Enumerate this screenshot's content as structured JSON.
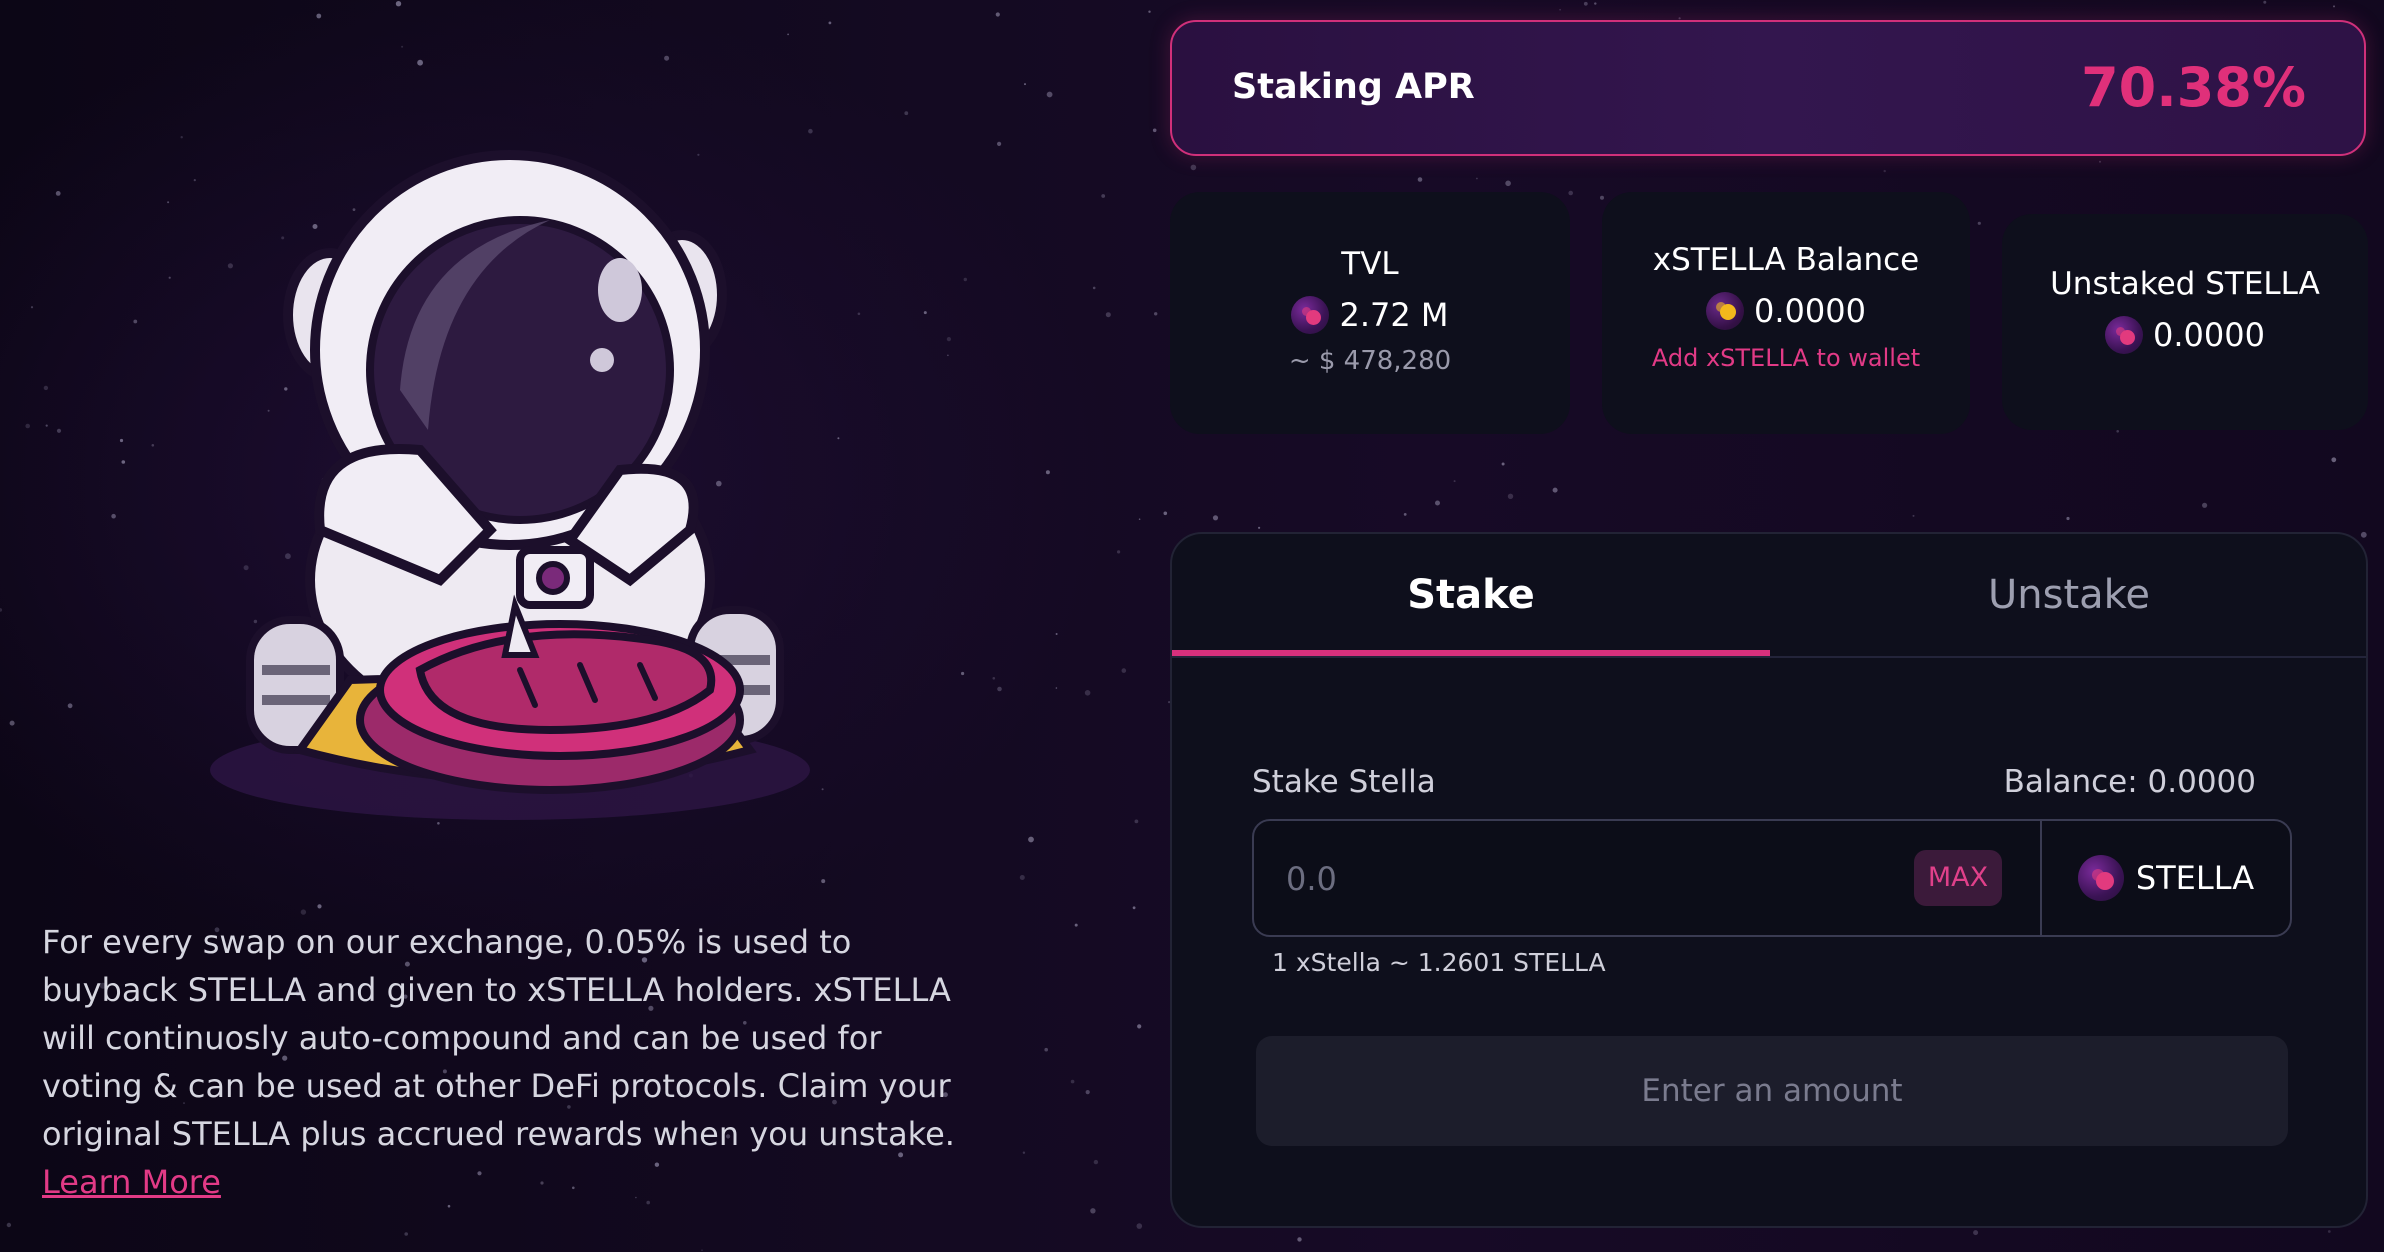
{
  "staking_apr": {
    "label": "Staking APR",
    "value": "70.38%"
  },
  "stats": {
    "tvl": {
      "title": "TVL",
      "amount": "2.72 M",
      "usd": "~ $ 478,280",
      "icon": "stella-token-icon"
    },
    "xstella_balance": {
      "title": "xSTELLA Balance",
      "amount": "0.0000",
      "link": "Add xSTELLA to wallet",
      "icon": "xstella-token-icon"
    },
    "unstaked": {
      "title": "Unstaked STELLA",
      "amount": "0.0000",
      "icon": "stella-token-icon"
    }
  },
  "tabs": [
    {
      "label": "Stake",
      "active": true
    },
    {
      "label": "Unstake",
      "active": false
    }
  ],
  "form": {
    "field_label": "Stake Stella",
    "balance": "Balance: 0.0000",
    "placeholder": "0.0",
    "max_label": "MAX",
    "token": "STELLA",
    "rate": "1 xStella ~ 1.2601 STELLA",
    "submit_label": "Enter an amount"
  },
  "description": {
    "text": "For every swap on our exchange, 0.05% is used to buyback STELLA and given to xSTELLA holders. xSTELLA will continuosly auto-compound and can be used for voting & can be used at other DeFi protocols. Claim your original STELLA plus accrued rewards when you unstake. ",
    "link": "Learn More"
  },
  "colors": {
    "accent": "#e0307a",
    "card_bg": "#0e0f1c",
    "page_bg": "#140a22",
    "muted_text": "#9a9aab",
    "gold": "#f2b81c"
  }
}
